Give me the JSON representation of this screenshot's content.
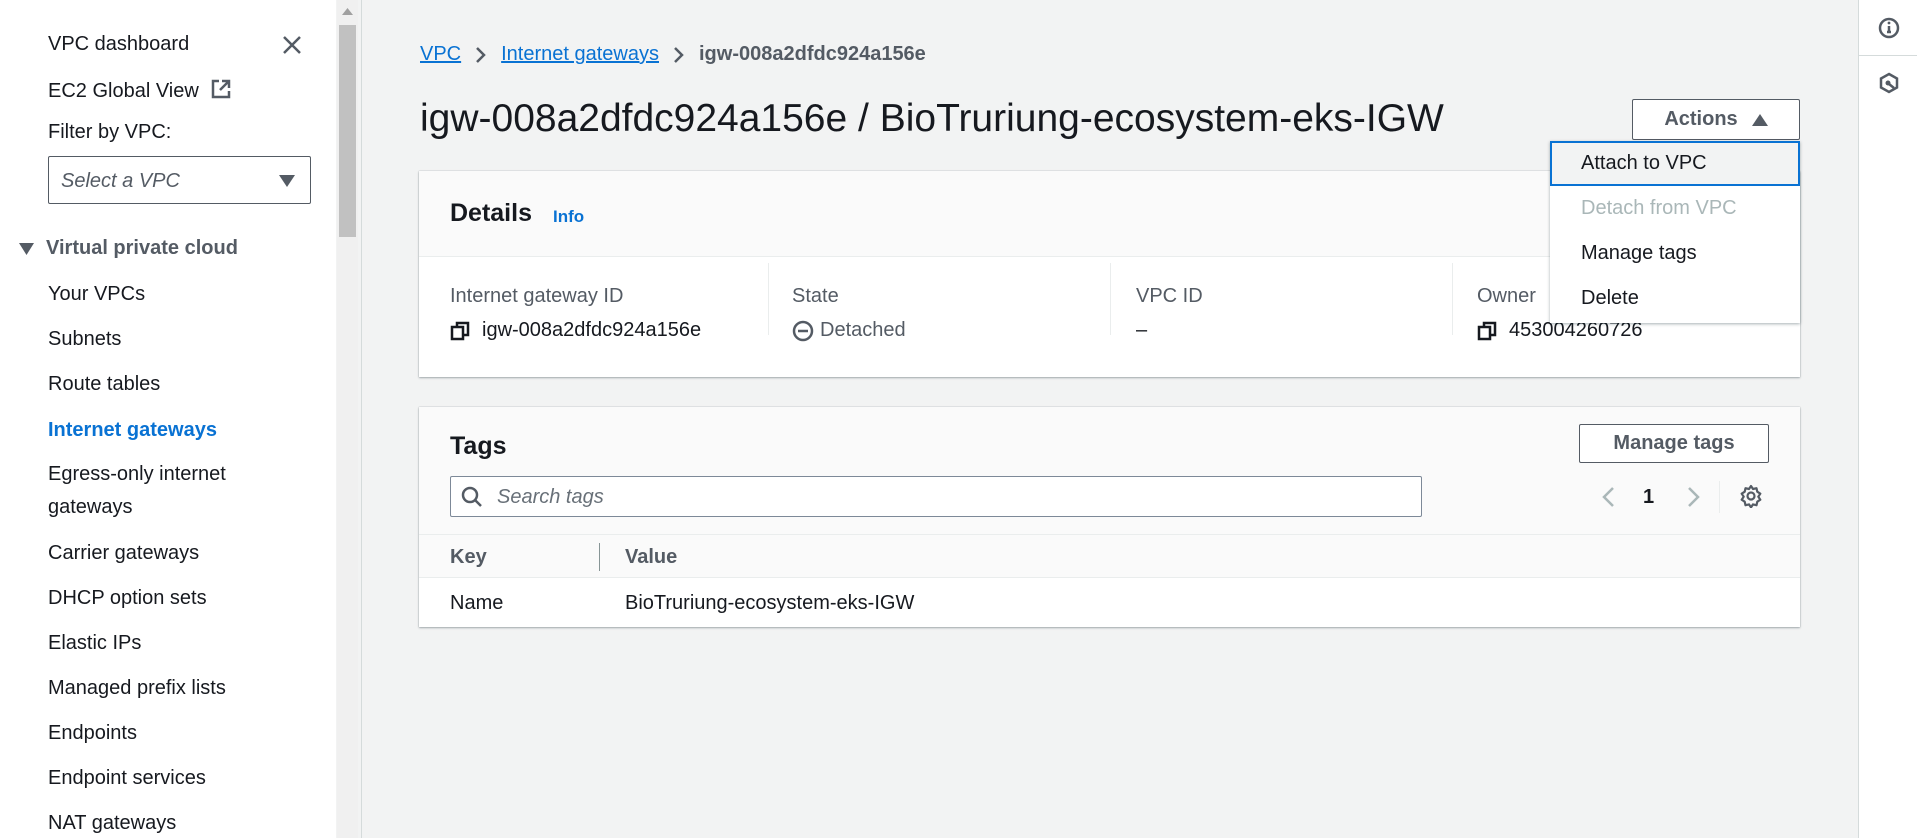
{
  "sidebar": {
    "dashboard": "VPC dashboard",
    "global_view": "EC2 Global View",
    "filter_label": "Filter by VPC:",
    "filter_placeholder": "Select a VPC",
    "section": "Virtual private cloud",
    "items": [
      {
        "label": "Your VPCs"
      },
      {
        "label": "Subnets"
      },
      {
        "label": "Route tables"
      },
      {
        "label": "Internet gateways",
        "active": true
      },
      {
        "label": "Egress-only internet gateways"
      },
      {
        "label": "Carrier gateways"
      },
      {
        "label": "DHCP option sets"
      },
      {
        "label": "Elastic IPs"
      },
      {
        "label": "Managed prefix lists"
      },
      {
        "label": "Endpoints"
      },
      {
        "label": "Endpoint services"
      },
      {
        "label": "NAT gateways"
      }
    ],
    "egress_line1": "Egress-only internet",
    "egress_line2": "gateways"
  },
  "breadcrumb": [
    "VPC",
    "Internet gateways",
    "igw-008a2dfdc924a156e"
  ],
  "title": "igw-008a2dfdc924a156e / BioTruriung-ecosystem-eks-IGW",
  "actions": {
    "label": "Actions",
    "menu": [
      "Attach to VPC",
      "Detach from VPC",
      "Manage tags",
      "Delete"
    ],
    "disabled": [
      "Detach from VPC"
    ]
  },
  "details": {
    "heading": "Details",
    "info": "Info",
    "fields": [
      {
        "label": "Internet gateway ID",
        "value": "igw-008a2dfdc924a156e"
      },
      {
        "label": "State",
        "value": "Detached"
      },
      {
        "label": "VPC ID",
        "value": "–"
      },
      {
        "label": "Owner",
        "value": "453004260726"
      }
    ]
  },
  "tags": {
    "heading": "Tags",
    "manage": "Manage tags",
    "search_placeholder": "Search tags",
    "page": "1",
    "columns": [
      "Key",
      "Value"
    ],
    "rows": [
      [
        "Name",
        "BioTruriung-ecosystem-eks-IGW"
      ]
    ]
  },
  "colors": {
    "link": "#0972d3",
    "background": "#f2f3f3",
    "text": "#16191f"
  }
}
